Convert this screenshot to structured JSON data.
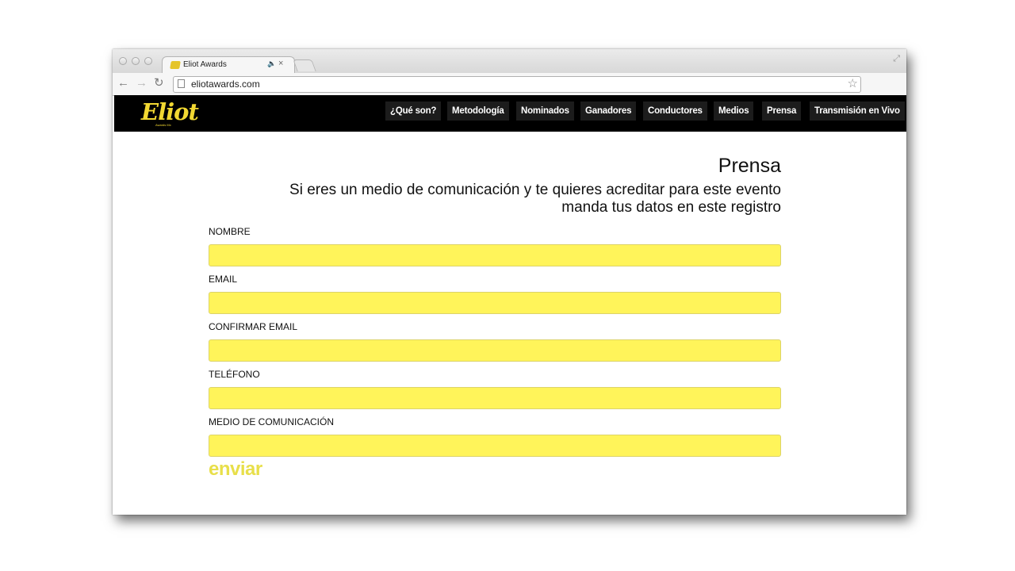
{
  "browser": {
    "tab_title": "Eliot Awards",
    "url": "eliotawards.com",
    "icons": {
      "back": "back-arrow-icon",
      "forward": "forward-arrow-icon",
      "reload": "reload-icon",
      "bookmark": "star-icon",
      "audio": "speaker-icon",
      "close": "close-icon"
    }
  },
  "site": {
    "logo": "Eliot",
    "logo_sub": "Awards Mx",
    "nav": [
      "¿Qué son?",
      "Metodología",
      "Nominados",
      "Ganadores",
      "Conductores",
      "Medios",
      "Prensa",
      "Transmisión en Vivo"
    ]
  },
  "page": {
    "heading": "Prensa",
    "intro": "Si eres un medio de comunicación y te quieres acreditar para este evento manda tus datos en este registro",
    "fields": [
      {
        "label": "NOMBRE",
        "value": ""
      },
      {
        "label": "EMAIL",
        "value": ""
      },
      {
        "label": "CONFIRMAR EMAIL",
        "value": ""
      },
      {
        "label": "TELÉFONO",
        "value": ""
      },
      {
        "label": "MEDIO DE COMUNICACIÓN",
        "value": ""
      }
    ],
    "submit": "enviar"
  },
  "colors": {
    "accent_yellow": "#fff45a",
    "logo_yellow": "#f2d832",
    "nav_bg": "#000000"
  }
}
